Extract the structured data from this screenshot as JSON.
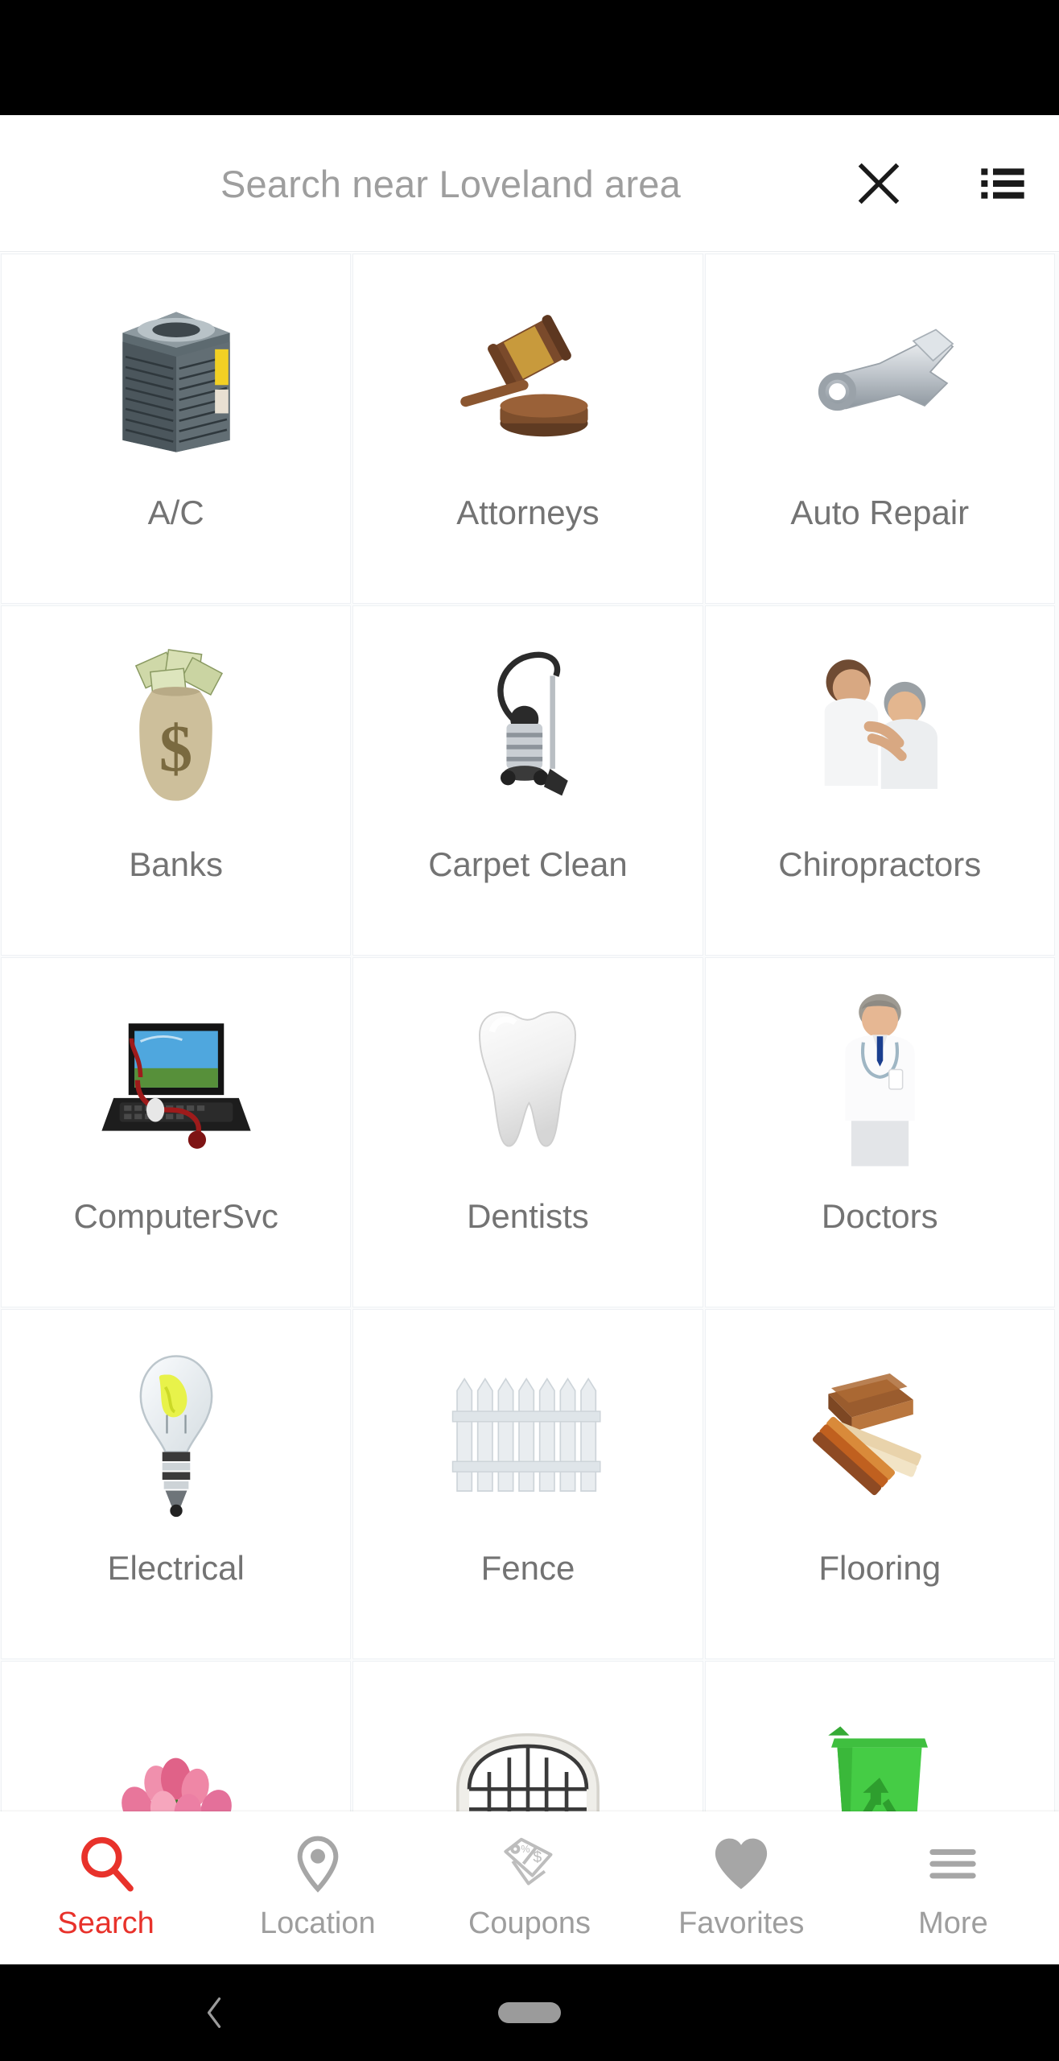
{
  "app": {
    "accent_color": "#e8322b",
    "label_color": "#737373",
    "placeholder_color": "#9e9e9e"
  },
  "statusbar": {
    "present": true
  },
  "header": {
    "search_value": "",
    "search_placeholder": "Search near Loveland area",
    "clear_icon": "close-icon",
    "menu_icon": "list-menu-icon"
  },
  "grid": {
    "columns": 3,
    "items": [
      {
        "label": "A/C",
        "icon": "air-conditioner-unit-image"
      },
      {
        "label": "Attorneys",
        "icon": "gavel-image"
      },
      {
        "label": "Auto Repair",
        "icon": "wrench-image"
      },
      {
        "label": "Banks",
        "icon": "money-bag-image"
      },
      {
        "label": "Carpet Clean",
        "icon": "vacuum-cleaner-image"
      },
      {
        "label": "Chiropractors",
        "icon": "chiropractic-adjustment-photo"
      },
      {
        "label": "ComputerSvc",
        "icon": "laptop-stethoscope-image"
      },
      {
        "label": "Dentists",
        "icon": "tooth-image"
      },
      {
        "label": "Doctors",
        "icon": "doctor-photo"
      },
      {
        "label": "Electrical",
        "icon": "light-bulb-image"
      },
      {
        "label": "Fence",
        "icon": "picket-fence-image"
      },
      {
        "label": "Flooring",
        "icon": "wood-flooring-samples-image"
      },
      {
        "label": "",
        "icon": "pink-flowers-image"
      },
      {
        "label": "",
        "icon": "arched-window-image"
      },
      {
        "label": "",
        "icon": "green-recycling-bin-image"
      }
    ]
  },
  "tabbar": {
    "items": [
      {
        "label": "Search",
        "icon": "search-icon",
        "active": true
      },
      {
        "label": "Location",
        "icon": "location-pin-icon",
        "active": false
      },
      {
        "label": "Coupons",
        "icon": "price-tag-icon",
        "active": false
      },
      {
        "label": "Favorites",
        "icon": "heart-icon",
        "active": false
      },
      {
        "label": "More",
        "icon": "hamburger-icon",
        "active": false
      }
    ]
  },
  "sysnav": {
    "back_icon": "back-chevron-icon",
    "home_indicator": "home-pill-indicator"
  }
}
